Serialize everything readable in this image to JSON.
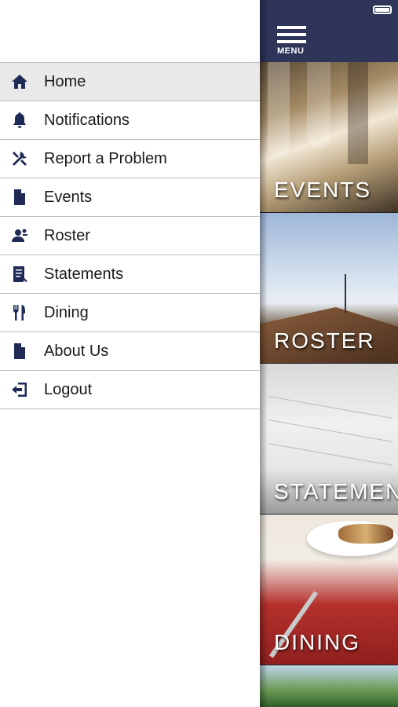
{
  "drawer": {
    "items": [
      {
        "label": "Home",
        "icon": "home-icon",
        "active": true
      },
      {
        "label": "Notifications",
        "icon": "bell-icon",
        "active": false
      },
      {
        "label": "Report a Problem",
        "icon": "tools-icon",
        "active": false
      },
      {
        "label": "Events",
        "icon": "document-icon",
        "active": false
      },
      {
        "label": "Roster",
        "icon": "person-icon",
        "active": false
      },
      {
        "label": "Statements",
        "icon": "statement-icon",
        "active": false
      },
      {
        "label": "Dining",
        "icon": "utensils-icon",
        "active": false
      },
      {
        "label": "About Us",
        "icon": "document-icon",
        "active": false
      },
      {
        "label": "Logout",
        "icon": "logout-icon",
        "active": false
      }
    ]
  },
  "header": {
    "menu_label": "MENU"
  },
  "tiles": [
    {
      "label": "EVENTS"
    },
    {
      "label": "ROSTER"
    },
    {
      "label": "STATEMENTS"
    },
    {
      "label": "DINING"
    }
  ],
  "colors": {
    "header_bg": "#2e3559",
    "icon": "#1f2a57",
    "active_row": "#e9e9e9"
  }
}
